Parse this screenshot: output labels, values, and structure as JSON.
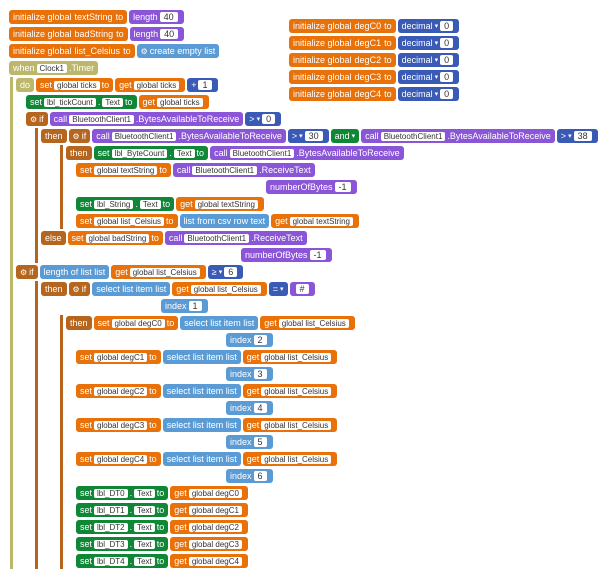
{
  "kw": {
    "init": "initialize global",
    "to": "to",
    "length": "length",
    "decimal": "decimal",
    "create_empty": "create empty list",
    "when": "when",
    "do": "do",
    "set": "set",
    "get": "get",
    "if": "if",
    "then": "then",
    "else": "else",
    "call": "call",
    "text": "Text",
    "lfcr": "list from csv row  text",
    "bavail": ".BytesAvailableToReceive",
    "rtext": ".ReceiveText",
    "nbytes": "numberOfBytes",
    "lol": "length of list  list",
    "sli": "select list item  list",
    "idx": "index",
    "and": "and",
    "timer": ".Timer"
  },
  "v": {
    "textString": "textString",
    "badString": "badString",
    "listC": "list_Celsius",
    "deg0": "degC0",
    "deg1": "degC1",
    "deg2": "degC2",
    "deg3": "degC3",
    "deg4": "degC4",
    "ticks": "global ticks",
    "gtxt": "global textString",
    "gbad": "global badString",
    "glc": "global list_Celsius",
    "gd0": "global degC0",
    "gd1": "global degC1",
    "gd2": "global degC2",
    "gd3": "global degC3",
    "gd4": "global degC4"
  },
  "c": {
    "clock": "Clock1",
    "bt": "BluetoothClient1",
    "tick": "lbl_tickCount",
    "bcnt": "lbl_ByteCount",
    "str": "lbl_String",
    "dt0": "lbl_DT0",
    "dt1": "lbl_DT1",
    "dt2": "lbl_DT2",
    "dt3": "lbl_DT3",
    "dt4": "lbl_DT4"
  },
  "n": {
    "n40": "40",
    "n0": "0",
    "n1": "1",
    "nm1": "-1",
    "n30": "30",
    "n38": "38",
    "n6": "6",
    "n2": "2",
    "n3": "3",
    "n4": "4",
    "n5": "5"
  },
  "op": {
    "plus": "+",
    "gt": ">",
    "ge": "≥",
    "eq": "=",
    "hash": "#"
  }
}
